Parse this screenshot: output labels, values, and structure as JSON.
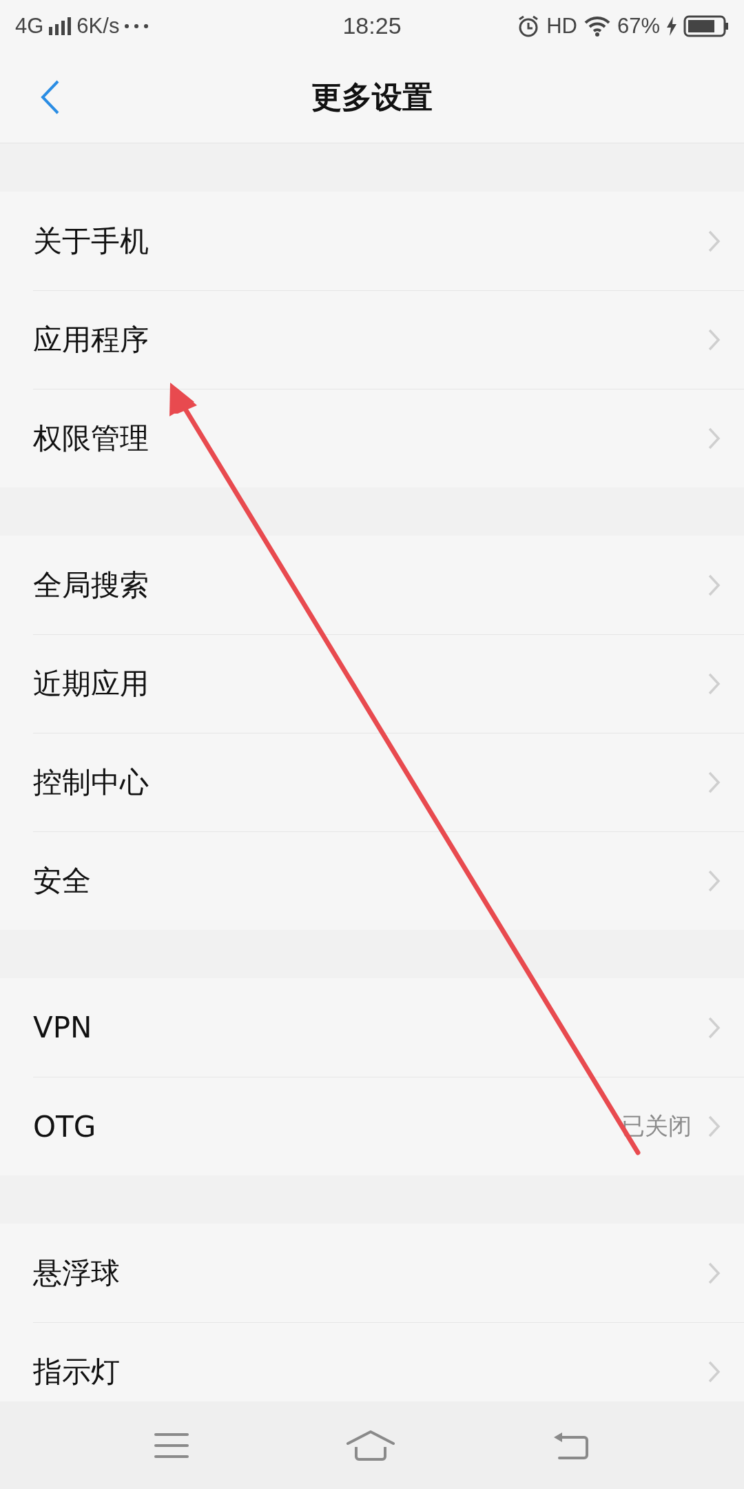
{
  "status_bar": {
    "network": "4G",
    "speed": "6K/s",
    "time": "18:25",
    "hd": "HD",
    "battery": "67%"
  },
  "header": {
    "title": "更多设置"
  },
  "groups": [
    {
      "items": [
        {
          "label": "关于手机"
        },
        {
          "label": "应用程序"
        },
        {
          "label": "权限管理"
        }
      ]
    },
    {
      "items": [
        {
          "label": "全局搜索"
        },
        {
          "label": "近期应用"
        },
        {
          "label": "控制中心"
        },
        {
          "label": "安全"
        }
      ]
    },
    {
      "items": [
        {
          "label": "VPN"
        },
        {
          "label": "OTG",
          "value": "已关闭"
        }
      ]
    },
    {
      "items": [
        {
          "label": "悬浮球"
        },
        {
          "label": "指示灯"
        }
      ]
    }
  ]
}
